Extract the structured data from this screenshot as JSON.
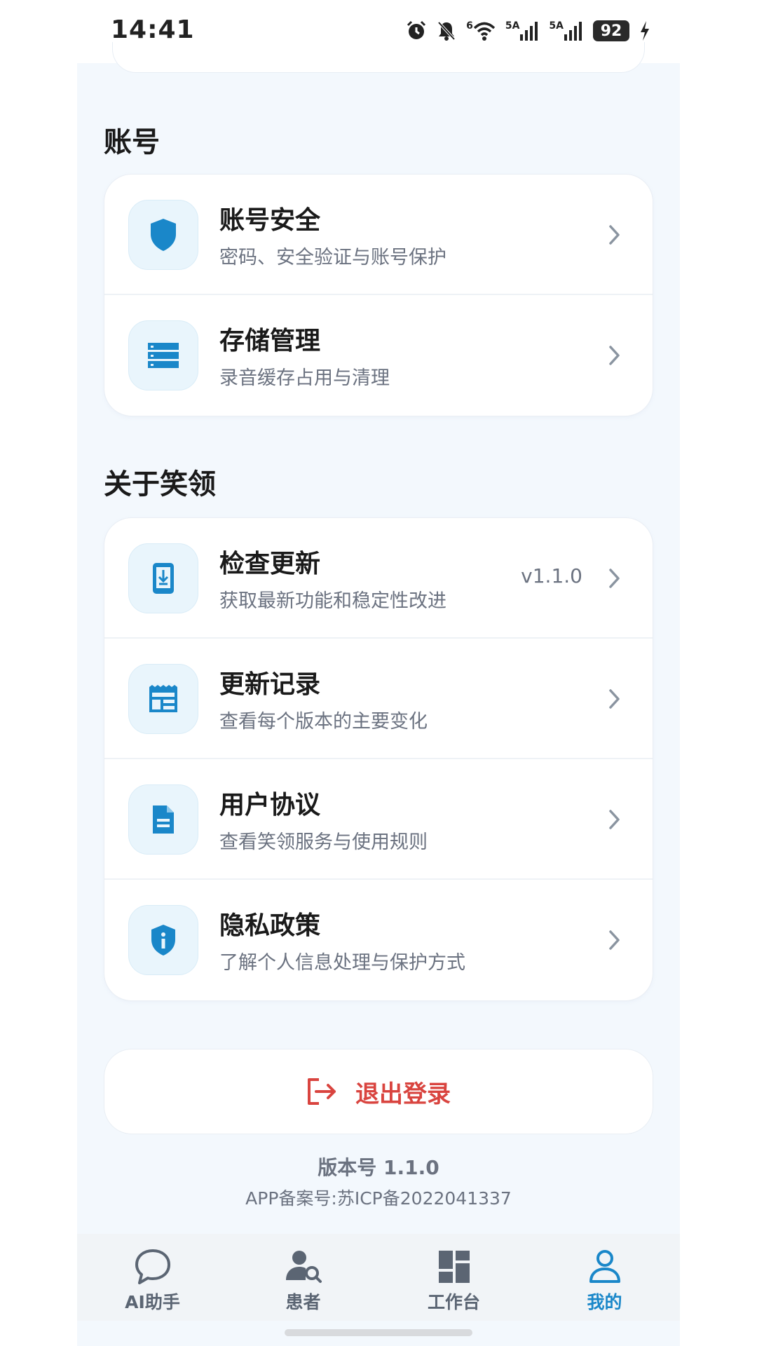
{
  "status_bar": {
    "time": "14:41",
    "network_1": "6",
    "network_2": "5A",
    "network_3": "5A",
    "battery": "92"
  },
  "colors": {
    "accent": "#1a87c9",
    "danger": "#d9443f",
    "background": "#f3f8fd"
  },
  "account_section": {
    "title": "账号",
    "items": [
      {
        "title": "账号安全",
        "subtitle": "密码、安全验证与账号保护",
        "icon": "shield-icon"
      },
      {
        "title": "存储管理",
        "subtitle": "录音缓存占用与清理",
        "icon": "storage-icon"
      }
    ]
  },
  "about_section": {
    "title": "关于笑领",
    "items": [
      {
        "title": "检查更新",
        "subtitle": "获取最新功能和稳定性改进",
        "value": "v1.1.0",
        "icon": "phone-download-icon"
      },
      {
        "title": "更新记录",
        "subtitle": "查看每个版本的主要变化",
        "icon": "changelog-icon"
      },
      {
        "title": "用户协议",
        "subtitle": "查看笑领服务与使用规则",
        "icon": "document-icon"
      },
      {
        "title": "隐私政策",
        "subtitle": "了解个人信息处理与保护方式",
        "icon": "privacy-shield-icon"
      }
    ]
  },
  "logout": {
    "label": "退出登录",
    "icon": "logout-icon"
  },
  "footer": {
    "version": "版本号 1.1.0",
    "icp": "APP备案号:苏ICP备2022041337"
  },
  "tabs": [
    {
      "label": "AI助手",
      "icon": "chat-bubble-icon",
      "active": false
    },
    {
      "label": "患者",
      "icon": "patient-search-icon",
      "active": false
    },
    {
      "label": "工作台",
      "icon": "dashboard-icon",
      "active": false
    },
    {
      "label": "我的",
      "icon": "person-icon",
      "active": true
    }
  ]
}
